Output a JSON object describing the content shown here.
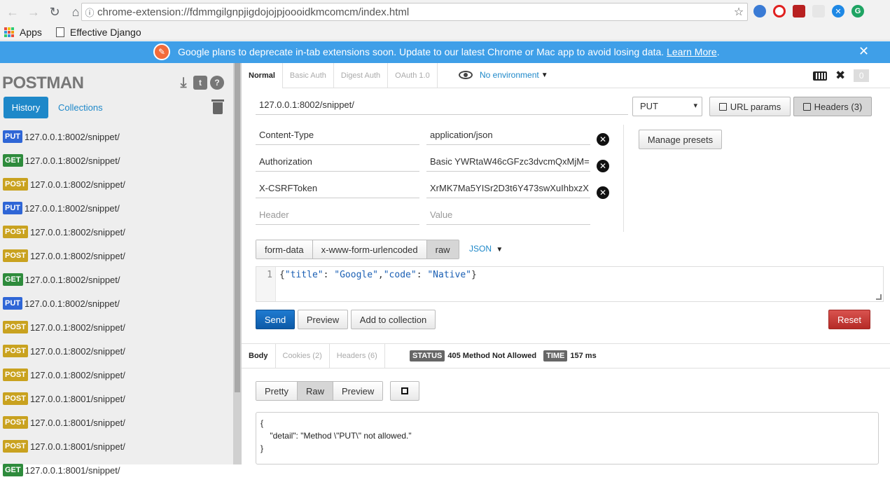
{
  "browser": {
    "url": "chrome-extension://fdmmgilgnpjigdojojpjoooidkmcomcm/index.html",
    "bookmarks": [
      "Apps",
      "Effective Django"
    ]
  },
  "banner": {
    "message": "Google plans to deprecate in-tab extensions soon. Update to our latest Chrome or Mac app to avoid losing data.",
    "link": "Learn More"
  },
  "sidebar": {
    "brand": "POSTMAN",
    "tabs": {
      "history": "History",
      "collections": "Collections"
    },
    "history": [
      {
        "method": "PUT",
        "url": "127.0.0.1:8002/snippet/"
      },
      {
        "method": "GET",
        "url": "127.0.0.1:8002/snippet/"
      },
      {
        "method": "POST",
        "url": "127.0.0.1:8002/snippet/"
      },
      {
        "method": "PUT",
        "url": "127.0.0.1:8002/snippet/"
      },
      {
        "method": "POST",
        "url": "127.0.0.1:8002/snippet/"
      },
      {
        "method": "POST",
        "url": "127.0.0.1:8002/snippet/"
      },
      {
        "method": "GET",
        "url": "127.0.0.1:8002/snippet/"
      },
      {
        "method": "PUT",
        "url": "127.0.0.1:8002/snippet/"
      },
      {
        "method": "POST",
        "url": "127.0.0.1:8002/snippet/"
      },
      {
        "method": "POST",
        "url": "127.0.0.1:8002/snippet/"
      },
      {
        "method": "POST",
        "url": "127.0.0.1:8002/snippet/"
      },
      {
        "method": "POST",
        "url": "127.0.0.1:8001/snippet/"
      },
      {
        "method": "POST",
        "url": "127.0.0.1:8001/snippet/"
      },
      {
        "method": "POST",
        "url": "127.0.0.1:8001/snippet/"
      },
      {
        "method": "GET",
        "url": "127.0.0.1:8001/snippet/"
      }
    ]
  },
  "auth_tabs": [
    "Normal",
    "Basic Auth",
    "Digest Auth",
    "OAuth 1.0"
  ],
  "environment": "No environment",
  "counter": "0",
  "request": {
    "url": "127.0.0.1:8002/snippet/",
    "method": "PUT",
    "url_params_label": "URL params",
    "headers_label": "Headers (3)"
  },
  "headers": [
    {
      "key": "Content-Type",
      "value": "application/json"
    },
    {
      "key": "Authorization",
      "value": "Basic YWRtaW46cGFzc3dvcmQxMjM="
    },
    {
      "key": "X-CSRFToken",
      "value": "XrMK7Ma5YISr2D3t6Y473swXuIhbxzX"
    }
  ],
  "header_placeholders": {
    "key": "Header",
    "value": "Value"
  },
  "manage_presets": "Manage presets",
  "body_tabs": [
    "form-data",
    "x-www-form-urlencoded",
    "raw"
  ],
  "body_format": "JSON",
  "editor": {
    "line": "1",
    "p1": "{",
    "k1": "\"title\"",
    "c1": ": ",
    "v1": "\"Google\"",
    "sep": ",",
    "k2": "\"code\"",
    "c2": ": ",
    "v2": "\"Native\"",
    "p2": "}"
  },
  "actions": {
    "send": "Send",
    "preview": "Preview",
    "add": "Add to collection",
    "reset": "Reset"
  },
  "response": {
    "tabs": [
      "Body",
      "Cookies (2)",
      "Headers (6)"
    ],
    "status_label": "STATUS",
    "status": "405 Method Not Allowed",
    "time_label": "TIME",
    "time": "157 ms",
    "view_tabs": [
      "Pretty",
      "Raw",
      "Preview"
    ],
    "body": "{\n    \"detail\": \"Method \\\"PUT\\\" not allowed.\"\n}"
  }
}
